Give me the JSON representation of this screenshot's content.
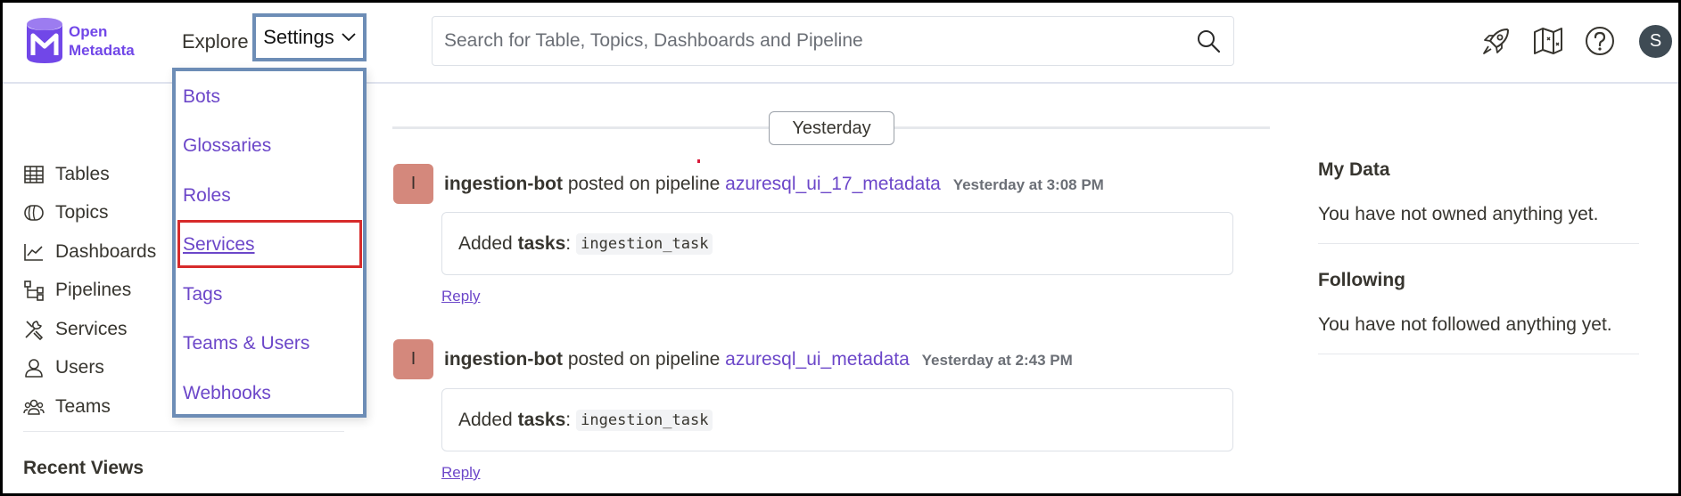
{
  "app": {
    "logo_line1": "Open",
    "logo_line2": "Metadata"
  },
  "nav": {
    "explore": "Explore",
    "settings": "Settings",
    "search_placeholder": "Search for Table, Topics, Dashboards and Pipeline",
    "icons": [
      "rocket-icon",
      "map-icon",
      "help-icon"
    ],
    "avatar_initial": "S"
  },
  "sidebar": {
    "items": [
      {
        "label": "Tables",
        "icon": "table-icon"
      },
      {
        "label": "Topics",
        "icon": "topic-icon"
      },
      {
        "label": "Dashboards",
        "icon": "dashboard-icon"
      },
      {
        "label": "Pipelines",
        "icon": "pipeline-icon"
      },
      {
        "label": "Services",
        "icon": "services-icon"
      },
      {
        "label": "Users",
        "icon": "user-icon"
      },
      {
        "label": "Teams",
        "icon": "teams-icon"
      }
    ],
    "recent_views": "Recent Views"
  },
  "settings_menu": {
    "items": [
      "Bots",
      "Glossaries",
      "Roles",
      "Services",
      "Tags",
      "Teams & Users",
      "Webhooks"
    ],
    "highlighted": "Services"
  },
  "feed": {
    "day_label": "Yesterday",
    "posts": [
      {
        "avatar": "I",
        "user": "ingestion-bot",
        "action": "posted on pipeline",
        "entity": "azuresql_ui_17_metadata",
        "time": "Yesterday at 3:08 PM",
        "message_prefix": "Added",
        "message_field": "tasks",
        "message_value": "ingestion_task",
        "reply": "Reply"
      },
      {
        "avatar": "I",
        "user": "ingestion-bot",
        "action": "posted on pipeline",
        "entity": "azuresql_ui_metadata",
        "time": "Yesterday at 2:43 PM",
        "message_prefix": "Added",
        "message_field": "tasks",
        "message_value": "ingestion_task",
        "reply": "Reply"
      }
    ]
  },
  "right_panel": {
    "my_data_title": "My Data",
    "my_data_empty": "You have not owned anything yet.",
    "following_title": "Following",
    "following_empty": "You have not followed anything yet."
  },
  "colors": {
    "brand": "#7147e8",
    "link": "#6c47c9",
    "highlight_border": "#6d8db6",
    "active_border": "#d72b2b"
  }
}
